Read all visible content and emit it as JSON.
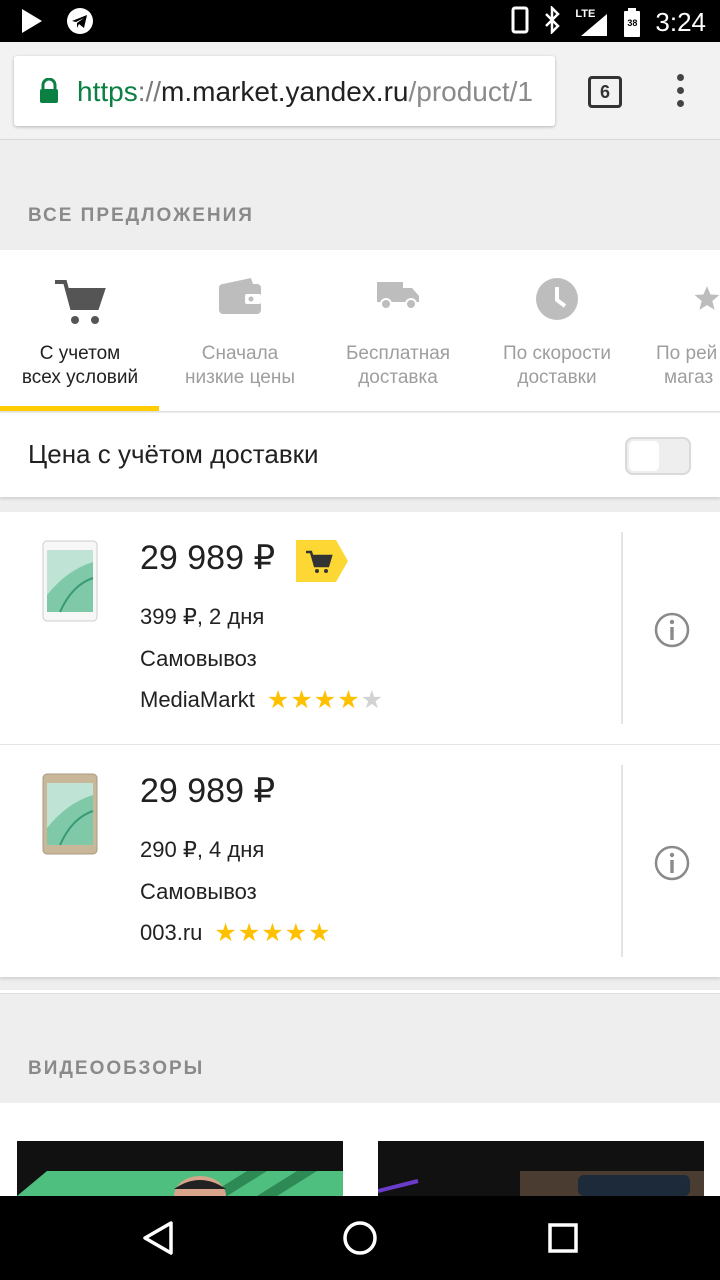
{
  "status_bar": {
    "time": "3:24",
    "network": "LTE",
    "battery": "38",
    "icons": [
      "play-icon",
      "telegram-icon",
      "phone-icon",
      "bluetooth-icon",
      "lte-signal-icon",
      "battery-icon"
    ]
  },
  "browser": {
    "url_scheme": "https",
    "url_sep": "://",
    "url_host": "m.market.yandex.ru",
    "url_path": "/product/1",
    "tab_count": "6"
  },
  "offers_section": {
    "title": "ВСЕ ПРЕДЛОЖЕНИЯ",
    "sort_tabs": [
      {
        "line1": "С учетом",
        "line2": "всех условий",
        "icon": "cart-icon",
        "active": true
      },
      {
        "line1": "Сначала",
        "line2": "низкие цены",
        "icon": "wallet-icon",
        "active": false
      },
      {
        "line1": "Бесплатная",
        "line2": "доставка",
        "icon": "truck-icon",
        "active": false
      },
      {
        "line1": "По скорости",
        "line2": "доставки",
        "icon": "clock-icon",
        "active": false
      },
      {
        "line1": "По рей",
        "line2": "магаз",
        "icon": "star-icon",
        "active": false
      }
    ],
    "toggle_label": "Цена с учётом доставки",
    "toggle_on": false
  },
  "offers": [
    {
      "price": "29 989 ₽",
      "delivery": "399 ₽, 2 дня",
      "pickup": "Самовывоз",
      "shop": "MediaMarkt",
      "rating": 4,
      "rating_max": 5,
      "has_cart_badge": true,
      "thumb_color": "white"
    },
    {
      "price": "29 989 ₽",
      "delivery": "290 ₽, 4 дня",
      "pickup": "Самовывоз",
      "shop": "003.ru",
      "rating": 5,
      "rating_max": 5,
      "has_cart_badge": false,
      "thumb_color": "gold"
    }
  ],
  "video_section": {
    "title": "ВИДЕООБЗОРЫ"
  },
  "colors": {
    "accent": "#ffcc00",
    "star": "#fdc100",
    "secure": "#0b8043"
  }
}
